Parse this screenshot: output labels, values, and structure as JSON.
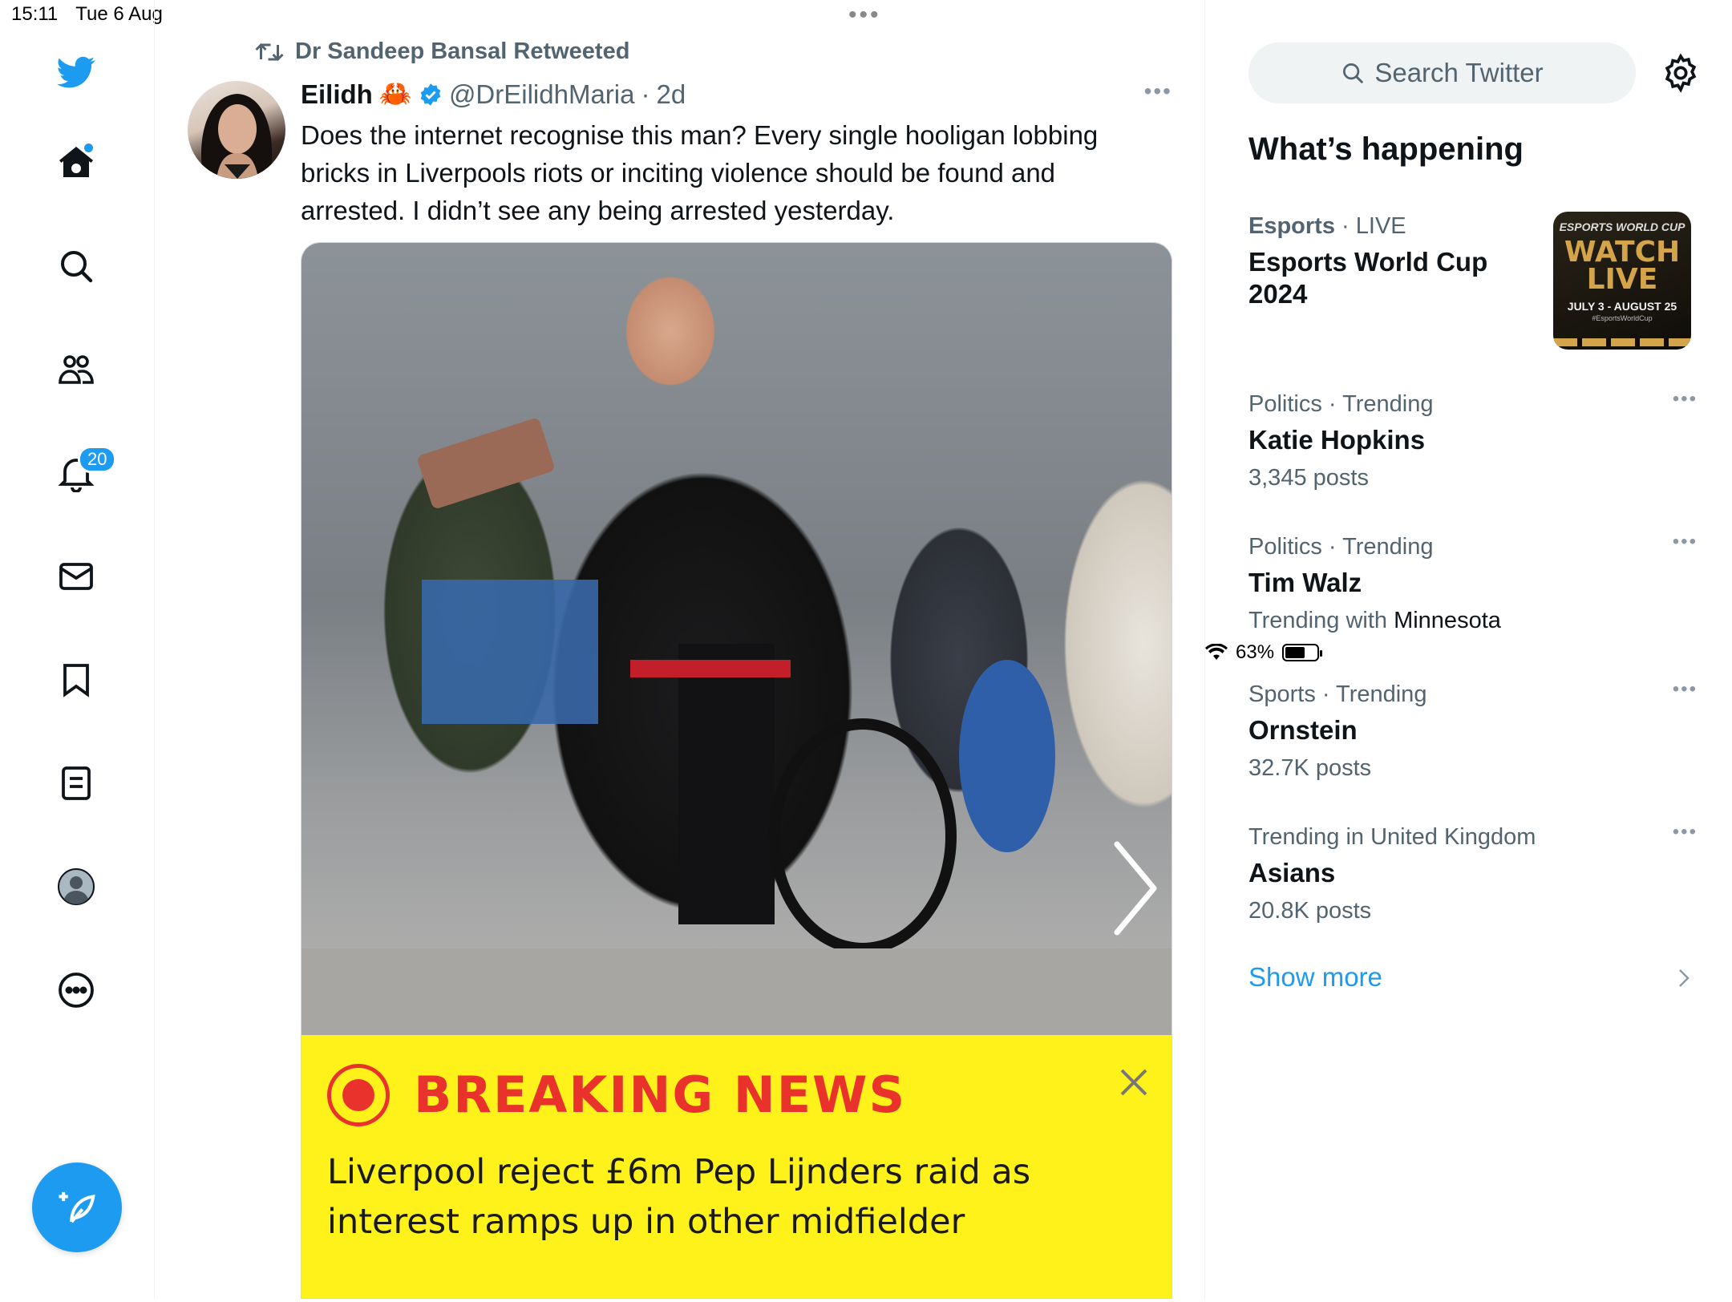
{
  "status_bar": {
    "time": "15:11",
    "date": "Tue 6 Aug",
    "battery": "63%",
    "battery_level": 0.63
  },
  "nav": {
    "notifications_badge": "20",
    "icons": [
      "twitter-logo-icon",
      "home-icon",
      "search-icon",
      "communities-icon",
      "notifications-icon",
      "messages-icon",
      "bookmarks-icon",
      "lists-icon",
      "profile-icon",
      "more-icon",
      "compose-icon"
    ]
  },
  "tweet": {
    "retweeted_by": "Dr Sandeep Bansal Retweeted",
    "author_name": "Eilidh",
    "author_emoji": "🦀",
    "handle": "@DrEilidhMaria",
    "separator": "·",
    "time": "2d",
    "text": "Does the internet recognise this man? Every single hooligan lobbing bricks in Liverpools riots or inciting violence should be found and arrested. I didn’t see any being arrested yesterday."
  },
  "news_banner": {
    "title": "BREAKING NEWS",
    "headline": "Liverpool reject £6m Pep Lijnders raid as interest ramps up in other midfielder",
    "accent_color": "#e8322b",
    "background_color": "#fff21a"
  },
  "sidebar": {
    "search_placeholder": "Search Twitter",
    "section_title": "What’s happening",
    "featured": {
      "category": "Esports",
      "separator": "·",
      "status": "LIVE",
      "title": "Esports World Cup 2024",
      "thumb_brand": "ESPORTS WORLD CUP",
      "thumb_cta": "WATCH LIVE",
      "thumb_dates": "JULY 3 - AUGUST 25",
      "thumb_tag": "#EsportsWorldCup"
    },
    "trends": [
      {
        "meta": "Politics · Trending",
        "topic": "Katie Hopkins",
        "count": "3,345 posts"
      },
      {
        "meta": "Politics · Trending",
        "topic": "Tim Walz",
        "count_prefix": "Trending with ",
        "count_highlight": "Minnesota"
      },
      {
        "meta": "Sports · Trending",
        "topic": "Ornstein",
        "count": "32.7K posts"
      },
      {
        "meta": "Trending in United Kingdom",
        "topic": "Asians",
        "count": "20.8K posts"
      }
    ],
    "show_more": "Show more"
  },
  "colors": {
    "accent": "#1d9bf0",
    "text": "#0f1419",
    "muted": "#536471"
  }
}
